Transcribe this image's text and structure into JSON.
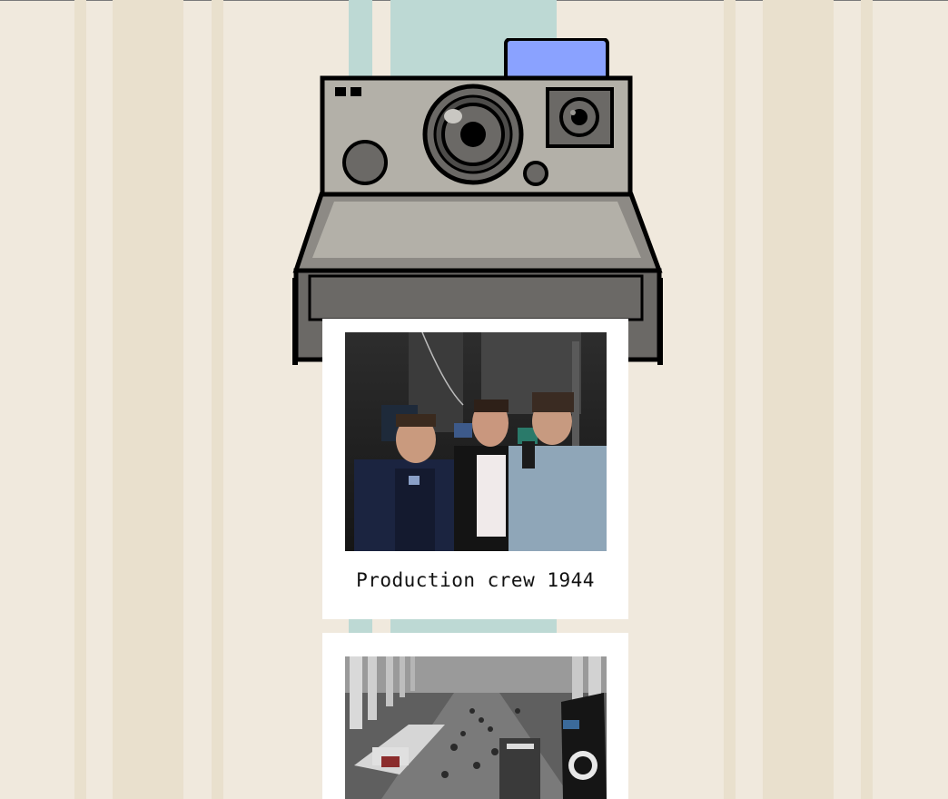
{
  "page": {
    "background": "#f0e9dd",
    "stripe_colors": [
      "#e9e0cd",
      "#e8dfca",
      "#bdd9d4"
    ]
  },
  "camera": {
    "icon": "instant-camera-icon",
    "flash_color": "#8aa2ff",
    "body_color": "#b3b0a8",
    "dark_color": "#6b6966"
  },
  "polaroids": [
    {
      "caption": "Production crew 1944",
      "photo_icon": "group-photo-image"
    },
    {
      "caption": "",
      "photo_icon": "exhibition-hall-photo-image"
    }
  ]
}
